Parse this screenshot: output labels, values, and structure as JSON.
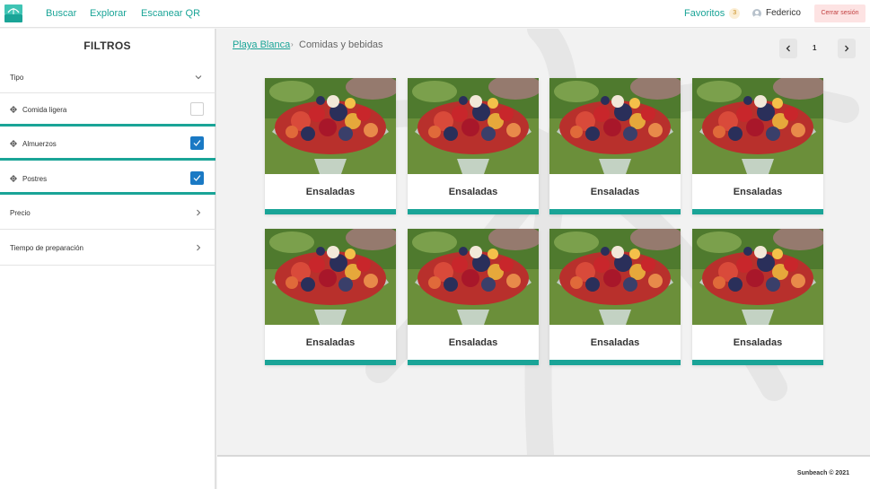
{
  "header": {
    "nav": [
      "Buscar",
      "Explorar",
      "Escanear QR"
    ],
    "favorites_label": "Favoritos",
    "favorites_count": "3",
    "user_name": "Federico",
    "logout_label": "Cerrar sesión"
  },
  "sidebar": {
    "title": "FILTROS",
    "groups": {
      "tipo": "Tipo",
      "precio": "Precio",
      "tiempo": "Tiempo de preparación"
    },
    "options": [
      {
        "label": "Comida ligera",
        "checked": false
      },
      {
        "label": "Almuerzos",
        "checked": true
      },
      {
        "label": "Postres",
        "checked": true
      }
    ]
  },
  "breadcrumb": {
    "home": "Playa Blanca",
    "current": "Comidas y bebidas"
  },
  "pagination": {
    "page": "1"
  },
  "cards": [
    {
      "title": "Ensaladas"
    },
    {
      "title": "Ensaladas"
    },
    {
      "title": "Ensaladas"
    },
    {
      "title": "Ensaladas"
    },
    {
      "title": "Ensaladas"
    },
    {
      "title": "Ensaladas"
    },
    {
      "title": "Ensaladas"
    },
    {
      "title": "Ensaladas"
    }
  ],
  "footer": {
    "text": "Sunbeach © 2021"
  },
  "colors": {
    "accent": "#1aa497",
    "checkbox": "#1a79c4",
    "logout_bg": "#fde3e3"
  }
}
